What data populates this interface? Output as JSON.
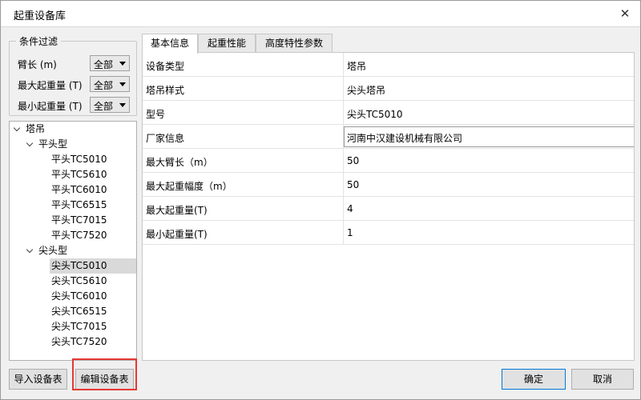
{
  "window": {
    "title": "起重设备库"
  },
  "filter": {
    "legend": "条件过滤",
    "rows": [
      {
        "label": "臂长 (m)",
        "value": "全部"
      },
      {
        "label": "最大起重量 (T)",
        "value": "全部"
      },
      {
        "label": "最小起重量 (T)",
        "value": "全部"
      }
    ]
  },
  "tree": {
    "root": "塔吊",
    "groups": [
      {
        "label": "平头型",
        "items": [
          "平头TC5010",
          "平头TC5610",
          "平头TC6010",
          "平头TC6515",
          "平头TC7015",
          "平头TC7520"
        ]
      },
      {
        "label": "尖头型",
        "items": [
          "尖头TC5010",
          "尖头TC5610",
          "尖头TC6010",
          "尖头TC6515",
          "尖头TC7015",
          "尖头TC7520"
        ]
      }
    ],
    "selected": "尖头TC5010"
  },
  "tabs": [
    {
      "label": "基本信息",
      "active": true
    },
    {
      "label": "起重性能",
      "active": false
    },
    {
      "label": "高度特性参数",
      "active": false
    }
  ],
  "properties": [
    {
      "key": "设备类型",
      "value": "塔吊"
    },
    {
      "key": "塔吊样式",
      "value": "尖头塔吊"
    },
    {
      "key": "型号",
      "value": "尖头TC5010"
    },
    {
      "key": "厂家信息",
      "value": "河南中汉建设机械有限公司"
    },
    {
      "key": "最大臂长（m）",
      "value": "50"
    },
    {
      "key": "最大起重幅度（m）",
      "value": "50"
    },
    {
      "key": "最大起重量(T)",
      "value": "4"
    },
    {
      "key": "最小起重量(T)",
      "value": "1"
    }
  ],
  "buttons": {
    "import": "导入设备表",
    "edit": "编辑设备表",
    "ok": "确定",
    "cancel": "取消"
  },
  "colors": {
    "highlight": "#e53935",
    "primary_border": "#0078d7"
  }
}
